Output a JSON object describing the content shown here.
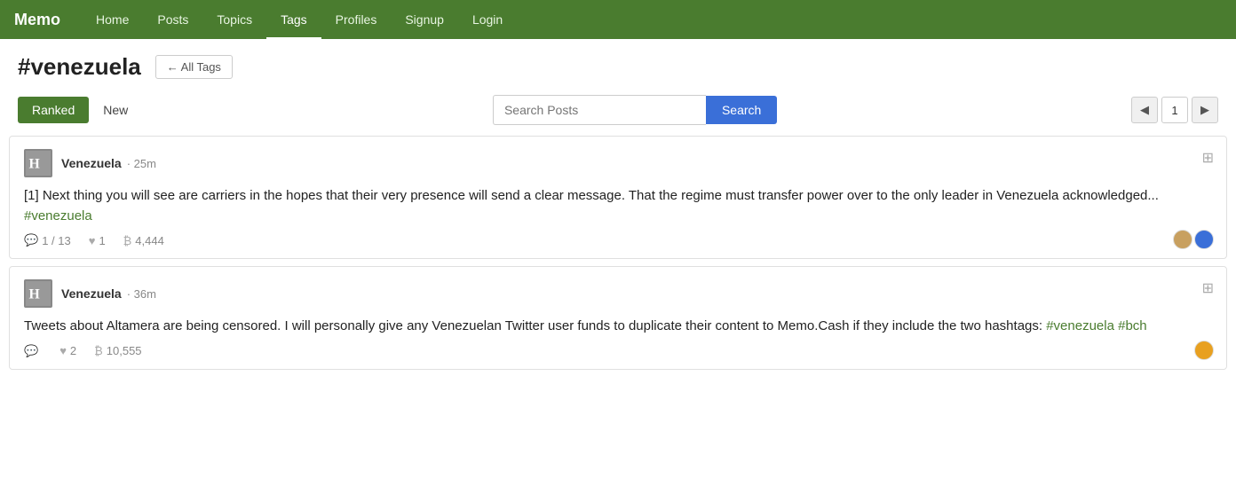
{
  "app": {
    "logo": "Memo"
  },
  "nav": {
    "links": [
      {
        "label": "Home",
        "href": "#",
        "active": false
      },
      {
        "label": "Posts",
        "href": "#",
        "active": false
      },
      {
        "label": "Topics",
        "href": "#",
        "active": false
      },
      {
        "label": "Tags",
        "href": "#",
        "active": true
      },
      {
        "label": "Profiles",
        "href": "#",
        "active": false
      },
      {
        "label": "Signup",
        "href": "#",
        "active": false
      },
      {
        "label": "Login",
        "href": "#",
        "active": false
      }
    ]
  },
  "page": {
    "title": "#venezuela",
    "all_tags_label": "← All Tags"
  },
  "filters": {
    "ranked_label": "Ranked",
    "new_label": "New"
  },
  "search": {
    "placeholder": "Search Posts",
    "button_label": "Search"
  },
  "pagination": {
    "current_page": "1",
    "prev_arrow": "◀",
    "next_arrow": "▶"
  },
  "posts": [
    {
      "username": "Venezuela",
      "time": "25m",
      "content": "[1] Next thing you will see are carriers in the hopes that their very presence will send a clear message. That the regime must transfer power over to the only leader in Venezuela acknowledged...",
      "tags": [
        "#venezuela"
      ],
      "comments": "1",
      "comment_total": "13",
      "likes": "1",
      "bch": "4,444",
      "has_avatars": true
    },
    {
      "username": "Venezuela",
      "time": "36m",
      "content_before": "Tweets about Altamera are being censored. I will personally give any Venezuelan Twitter user funds to duplicate their content to Memo.Cash if they include the two hashtags: ",
      "content_after": "",
      "tags": [
        "#venezuela",
        "#bch"
      ],
      "comments": "",
      "comment_total": "",
      "likes": "2",
      "bch": "10,555",
      "has_avatars": false,
      "has_single_avatar": true
    }
  ]
}
